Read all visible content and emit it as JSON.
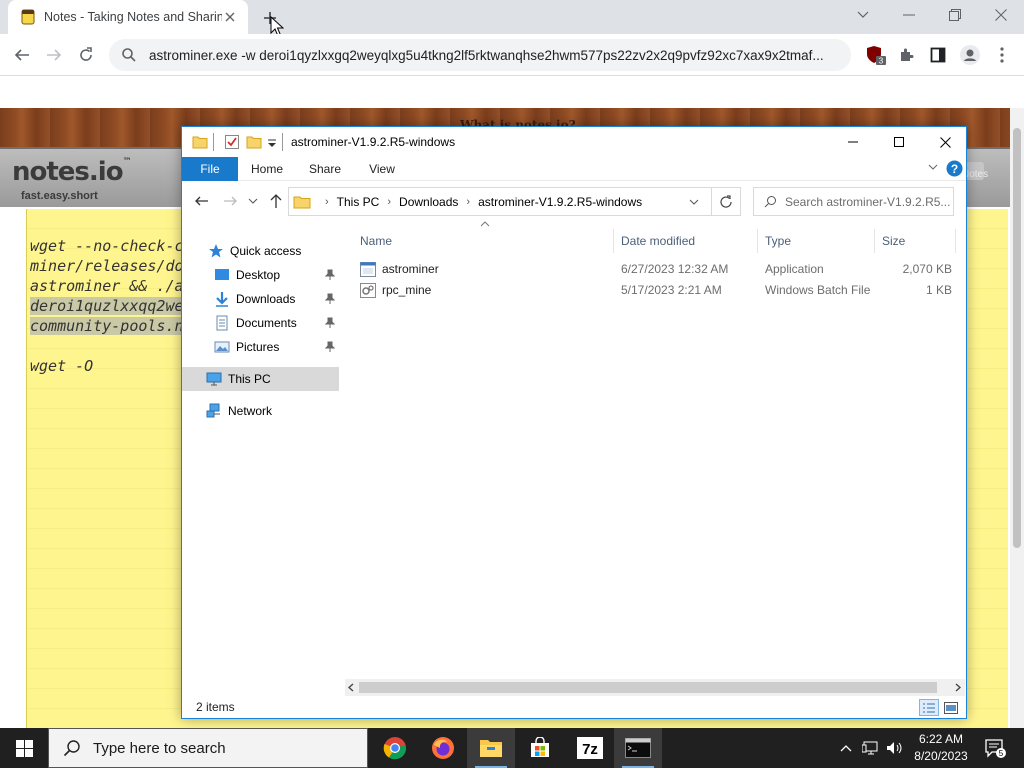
{
  "browser": {
    "tab": {
      "title": "Notes - Taking Notes and Sharing",
      "close_label": "close tab"
    },
    "new_tab_label": "+",
    "window_controls": {
      "tab_search": "tab search",
      "minimize": "minimize",
      "restore": "restore",
      "close": "close"
    },
    "nav": {
      "back": "back",
      "forward": "forward",
      "reload": "reload"
    },
    "omnibox": {
      "text": "astrominer.exe -w deroi1qyzlxxgq2weyqlxg5u4tkng2lf5rktwanqhse2hwm577ps22zv2x2q9pvfz92xc7xax9x2tmaf..."
    },
    "extensions": {
      "ublock_badge": "3"
    }
  },
  "notes_page": {
    "banner_text": "What is notes.io?",
    "logo": "notes.io",
    "logo_tm": "™",
    "tagline": "fast.easy.short",
    "notes_button": "Notes",
    "lines": [
      {
        "text": "wget --no-check-c",
        "highlight": false
      },
      {
        "text": "miner/releases/dow",
        "highlight": false
      },
      {
        "text": "astrominer && ./a",
        "highlight": false
      },
      {
        "text": "deroi1quzlxxqq2we",
        "highlight": true
      },
      {
        "text": "community-pools.n",
        "highlight": true
      },
      {
        "text": "wget -O",
        "highlight": false
      }
    ]
  },
  "explorer": {
    "title": "astrominer-V1.9.2.R5-windows",
    "ribbon_tabs": [
      "File",
      "Home",
      "Share",
      "View"
    ],
    "breadcrumb": [
      "This PC",
      "Downloads",
      "astrominer-V1.9.2.R5-windows"
    ],
    "breadcrumb_sep": "›",
    "search_placeholder": "Search astrominer-V1.9.2.R5...",
    "nav_pane": {
      "quick_access": "Quick access",
      "pinned": [
        "Desktop",
        "Downloads",
        "Documents",
        "Pictures"
      ],
      "this_pc": "This PC",
      "network": "Network"
    },
    "columns": {
      "name": "Name",
      "date": "Date modified",
      "type": "Type",
      "size": "Size"
    },
    "files": [
      {
        "name": "astrominer",
        "date": "6/27/2023 12:32 AM",
        "type": "Application",
        "size": "2,070 KB",
        "icon": "application-icon"
      },
      {
        "name": "rpc_mine",
        "date": "5/17/2023 2:21 AM",
        "type": "Windows Batch File",
        "size": "1 KB",
        "icon": "batch-file-icon"
      }
    ],
    "status": "2 items"
  },
  "taskbar": {
    "search_placeholder": "Type here to search",
    "apps": [
      "chrome",
      "firefox",
      "file-explorer",
      "microsoft-store",
      "7-zip",
      "terminal"
    ],
    "clock_time": "6:22 AM",
    "clock_date": "8/20/2023",
    "notification_count": "5"
  },
  "colors": {
    "accent": "#1979ca",
    "notepad": "#fff58f",
    "selection": "#d9d9d9",
    "taskbar": "#202020"
  }
}
